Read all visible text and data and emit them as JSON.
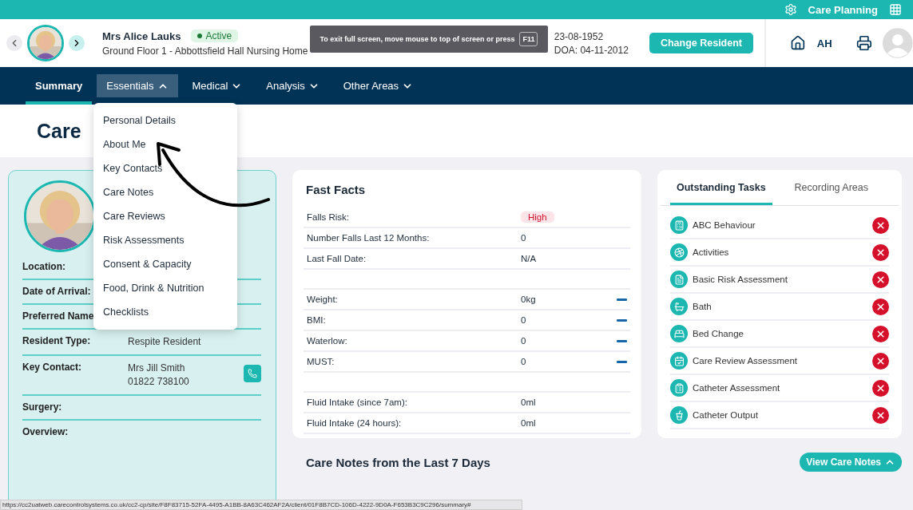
{
  "top_bar": {
    "app_name": "Care Planning"
  },
  "resident": {
    "name": "Mrs Alice Lauks",
    "status": "Active",
    "location": "Ground Floor 1 - Abbottsfield Hall Nursing Home",
    "dob": "23-08-1952",
    "doa": "DOA: 04-11-2012"
  },
  "change_button": "Change Resident",
  "user_initials": "AH",
  "fullscreen_notice": {
    "text": "To exit full screen, move mouse to top of screen or press",
    "key": "F11"
  },
  "nav": [
    {
      "label": "Summary",
      "selected": true,
      "dropdown": false,
      "expanded": false
    },
    {
      "label": "Essentials",
      "selected": false,
      "dropdown": true,
      "expanded": true
    },
    {
      "label": "Medical",
      "selected": false,
      "dropdown": true,
      "expanded": false
    },
    {
      "label": "Analysis",
      "selected": false,
      "dropdown": true,
      "expanded": false
    },
    {
      "label": "Other Areas",
      "selected": false,
      "dropdown": true,
      "expanded": false
    }
  ],
  "menu": [
    "Personal Details",
    "About Me",
    "Key Contacts",
    "Care Notes",
    "Care Reviews",
    "Risk Assessments",
    "Consent & Capacity",
    "Food, Drink & Nutrition",
    "Checklists"
  ],
  "page_title": "Care",
  "profile": {
    "fields": [
      {
        "label": "Location:",
        "phone": false
      },
      {
        "label": "Date of Arrival:",
        "phone": false
      },
      {
        "label": "Preferred Name",
        "phone": false
      },
      {
        "label": "Resident Type:",
        "values": [
          "Respite Resident"
        ],
        "phone": false
      },
      {
        "label": "Key Contact:",
        "values": [
          "Mrs Jill Smith",
          "01822 738100"
        ],
        "phone": true
      },
      {
        "label": "Surgery:",
        "phone": false
      },
      {
        "label": "Overview:",
        "phone": false
      }
    ]
  },
  "fast_facts": {
    "title": "Fast Facts",
    "groups": [
      [
        {
          "label": "Falls Risk:",
          "value": "High",
          "kind": "badge"
        },
        {
          "label": "Number Falls Last 12 Months:",
          "value": "0",
          "kind": "text"
        },
        {
          "label": "Last Fall Date:",
          "value": "N/A",
          "kind": "text"
        }
      ],
      [
        {
          "label": "Weight:",
          "value": "0kg",
          "kind": "trend"
        },
        {
          "label": "BMI:",
          "value": "0",
          "kind": "trend"
        },
        {
          "label": "Waterlow:",
          "value": "0",
          "kind": "trend"
        },
        {
          "label": "MUST:",
          "value": "0",
          "kind": "trend"
        }
      ],
      [
        {
          "label": "Fluid Intake (since 7am):",
          "value": "0ml",
          "kind": "text"
        },
        {
          "label": "Fluid Intake (24 hours):",
          "value": "0ml",
          "kind": "text"
        }
      ]
    ]
  },
  "tasks": {
    "tabs": [
      {
        "label": "Outstanding Tasks",
        "selected": true
      },
      {
        "label": "Recording Areas",
        "selected": false
      }
    ],
    "items": [
      {
        "label": "ABC Behaviour",
        "done": false
      },
      {
        "label": "Activities",
        "done": false
      },
      {
        "label": "Basic Risk Assessment",
        "done": false
      },
      {
        "label": "Bath",
        "done": false
      },
      {
        "label": "Bed Change",
        "done": false
      },
      {
        "label": "Care Review Assessment",
        "done": false
      },
      {
        "label": "Catheter Assessment",
        "done": false
      },
      {
        "label": "Catheter Output",
        "done": false
      }
    ]
  },
  "care_notes": {
    "title": "Care Notes from the Last 7 Days",
    "button": "View Care Notes"
  },
  "status_url": "https://cc2uatweb.carecontrolsystems.co.uk/cc2-cp/site/F8F83715-52FA-4495-A1BB-8A63C462AF2A/client/01F8B7CD-106D-4222-9D0A-F653B3C9C296/summary#"
}
